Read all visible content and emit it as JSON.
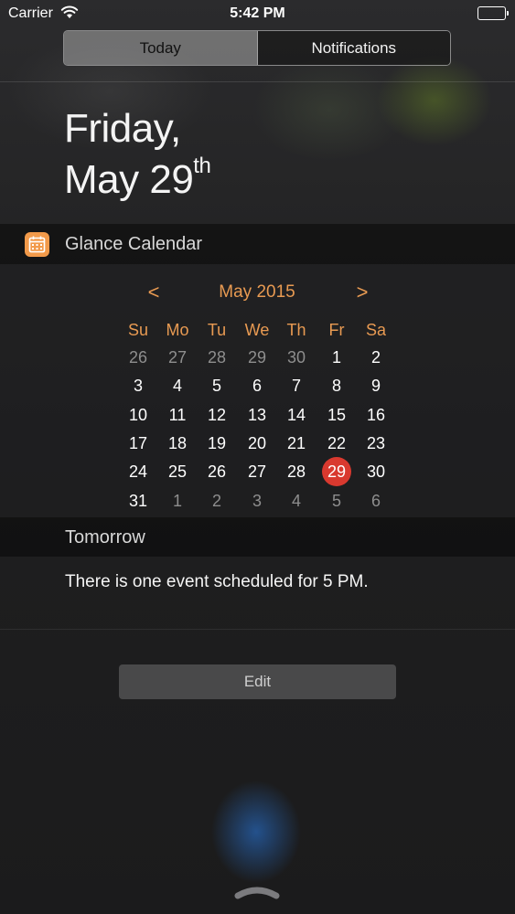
{
  "status_bar": {
    "carrier": "Carrier",
    "time": "5:42 PM",
    "wifi_icon": "wifi-icon",
    "battery_icon": "battery-icon",
    "battery_level": 1.0
  },
  "tabs": [
    {
      "label": "Today",
      "selected": true
    },
    {
      "label": "Notifications",
      "selected": false
    }
  ],
  "date": {
    "weekday": "Friday,",
    "month_day": "May 29",
    "suffix": "th"
  },
  "widget": {
    "icon": "calendar-icon",
    "icon_color": "#f29a4a",
    "title": "Glance Calendar"
  },
  "calendar": {
    "prev_label": "<",
    "next_label": ">",
    "month_title": "May 2015",
    "accent_color": "#e89a52",
    "today_color": "#d9392f",
    "weekdays": [
      "Su",
      "Mo",
      "Tu",
      "We",
      "Th",
      "Fr",
      "Sa"
    ],
    "weeks": [
      [
        {
          "d": "26",
          "muted": true
        },
        {
          "d": "27",
          "muted": true
        },
        {
          "d": "28",
          "muted": true
        },
        {
          "d": "29",
          "muted": true
        },
        {
          "d": "30",
          "muted": true
        },
        {
          "d": "1"
        },
        {
          "d": "2"
        }
      ],
      [
        {
          "d": "3"
        },
        {
          "d": "4"
        },
        {
          "d": "5"
        },
        {
          "d": "6"
        },
        {
          "d": "7"
        },
        {
          "d": "8"
        },
        {
          "d": "9"
        }
      ],
      [
        {
          "d": "10"
        },
        {
          "d": "11"
        },
        {
          "d": "12"
        },
        {
          "d": "13"
        },
        {
          "d": "14"
        },
        {
          "d": "15"
        },
        {
          "d": "16"
        }
      ],
      [
        {
          "d": "17"
        },
        {
          "d": "18"
        },
        {
          "d": "19"
        },
        {
          "d": "20"
        },
        {
          "d": "21"
        },
        {
          "d": "22"
        },
        {
          "d": "23"
        }
      ],
      [
        {
          "d": "24"
        },
        {
          "d": "25"
        },
        {
          "d": "26"
        },
        {
          "d": "27"
        },
        {
          "d": "28"
        },
        {
          "d": "29",
          "today": true
        },
        {
          "d": "30"
        }
      ],
      [
        {
          "d": "31"
        },
        {
          "d": "1",
          "muted": true
        },
        {
          "d": "2",
          "muted": true
        },
        {
          "d": "3",
          "muted": true
        },
        {
          "d": "4",
          "muted": true
        },
        {
          "d": "5",
          "muted": true
        },
        {
          "d": "6",
          "muted": true
        }
      ]
    ]
  },
  "tomorrow": {
    "label": "Tomorrow",
    "event_text": "There is one event scheduled for 5 PM."
  },
  "edit_label": "Edit",
  "handle_icon": "chevron-up-handle-icon"
}
